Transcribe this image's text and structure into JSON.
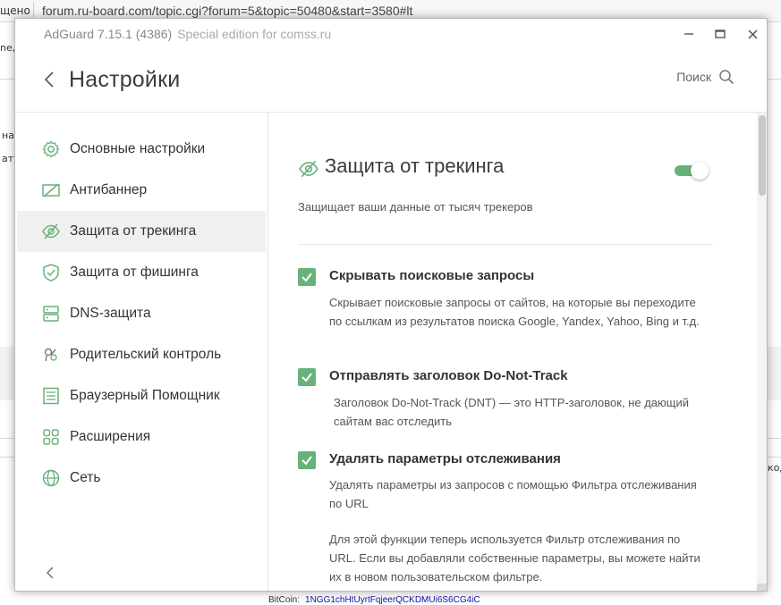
{
  "background": {
    "url": "forum.ru-board.com/topic.cgi?forum=5&topic=50480&start=3580#lt",
    "left_fragments": [
      "щено",
      "ne,",
      "на",
      "ату"
    ],
    "right_fragment": "код",
    "footer_label": "BitCoin:",
    "footer_address": "1NGG1chHtUyrtFqjeerQCKDMUi6S6CG4iC"
  },
  "window": {
    "app_title": "AdGuard 7.15.1 (4386)",
    "app_subtitle": "Special edition for comss.ru",
    "minimize_icon": "minimize-icon",
    "maximize_icon": "maximize-icon",
    "close_icon": "close-icon"
  },
  "header": {
    "title": "Настройки",
    "search_label": "Поиск"
  },
  "sidebar": {
    "items": [
      {
        "label": "Основные настройки",
        "icon": "gear-icon"
      },
      {
        "label": "Антибаннер",
        "icon": "antibanner-icon"
      },
      {
        "label": "Защита от трекинга",
        "icon": "eye-off-icon",
        "active": true
      },
      {
        "label": "Защита от фишинга",
        "icon": "shield-icon"
      },
      {
        "label": "DNS-защита",
        "icon": "server-icon"
      },
      {
        "label": "Родительский контроль",
        "icon": "parental-icon"
      },
      {
        "label": "Браузерный Помощник",
        "icon": "browser-icon"
      },
      {
        "label": "Расширения",
        "icon": "extensions-icon"
      },
      {
        "label": "Сеть",
        "icon": "globe-icon"
      }
    ]
  },
  "content": {
    "title": "Защита от трекинга",
    "toggle_on": true,
    "description": "Защищает ваши данные от тысяч трекеров",
    "options": [
      {
        "title": "Скрывать поисковые запросы",
        "checked": true,
        "description": "Скрывает поисковые запросы от сайтов, на которые вы переходите по ссылкам из результатов поиска Google, Yandex, Yahoo, Bing и т.д."
      },
      {
        "title": "Отправлять заголовок Do-Not-Track",
        "checked": true,
        "description": "Заголовок Do-Not-Track (DNT) — это HTTP-заголовок, не дающий сайтам вас отследить"
      },
      {
        "title": "Удалять параметры отслеживания",
        "checked": true,
        "description": "Удалять параметры из запросов с помощью Фильтра отслеживания по URL",
        "note": "Для этой функции теперь используется Фильтр отслеживания по URL. Если вы добавляли собственные параметры, вы можете найти их в новом пользовательском фильтре."
      }
    ]
  },
  "colors": {
    "accent": "#67b279",
    "text": "#333333"
  }
}
